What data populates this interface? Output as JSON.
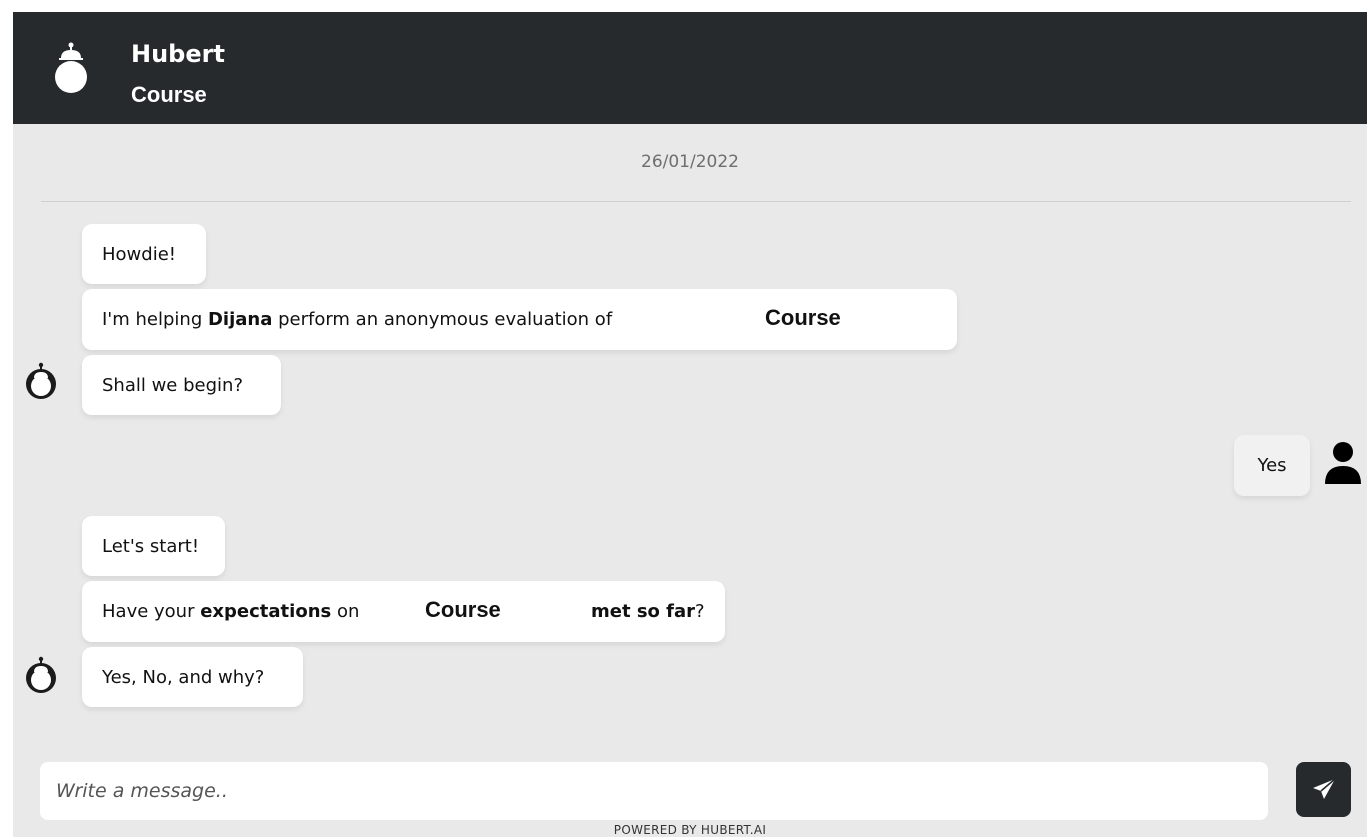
{
  "header": {
    "bot_name": "Hubert",
    "subtitle": "Course",
    "avatar_icon": "robot-avatar-icon"
  },
  "date_separator": "26/01/2022",
  "messages_group_1": {
    "msg1": "Howdie!",
    "msg2_prefix": "I'm helping ",
    "msg2_bold": "Dijana",
    "msg2_suffix": " perform an anonymous evaluation of",
    "msg2_course": "Course",
    "msg3": "Shall we begin?"
  },
  "user_reply": {
    "text": "Yes",
    "icon": "user-icon"
  },
  "messages_group_2": {
    "msg1": "Let's start!",
    "msg2_prefix": "Have your ",
    "msg2_bold": "expectations",
    "msg2_mid": " on ",
    "msg2_course": "Course",
    "msg2_bold2": "met so far",
    "msg2_end": "?",
    "msg3": "Yes, No, and why?"
  },
  "composer": {
    "placeholder": "Write a message..",
    "send_icon": "send-icon"
  },
  "footer": {
    "powered_by": "POWERED BY HUBERT.AI"
  },
  "colors": {
    "header_bg": "#262a2d",
    "chat_bg": "#e9e9e9",
    "bubble_bg": "#ffffff"
  }
}
